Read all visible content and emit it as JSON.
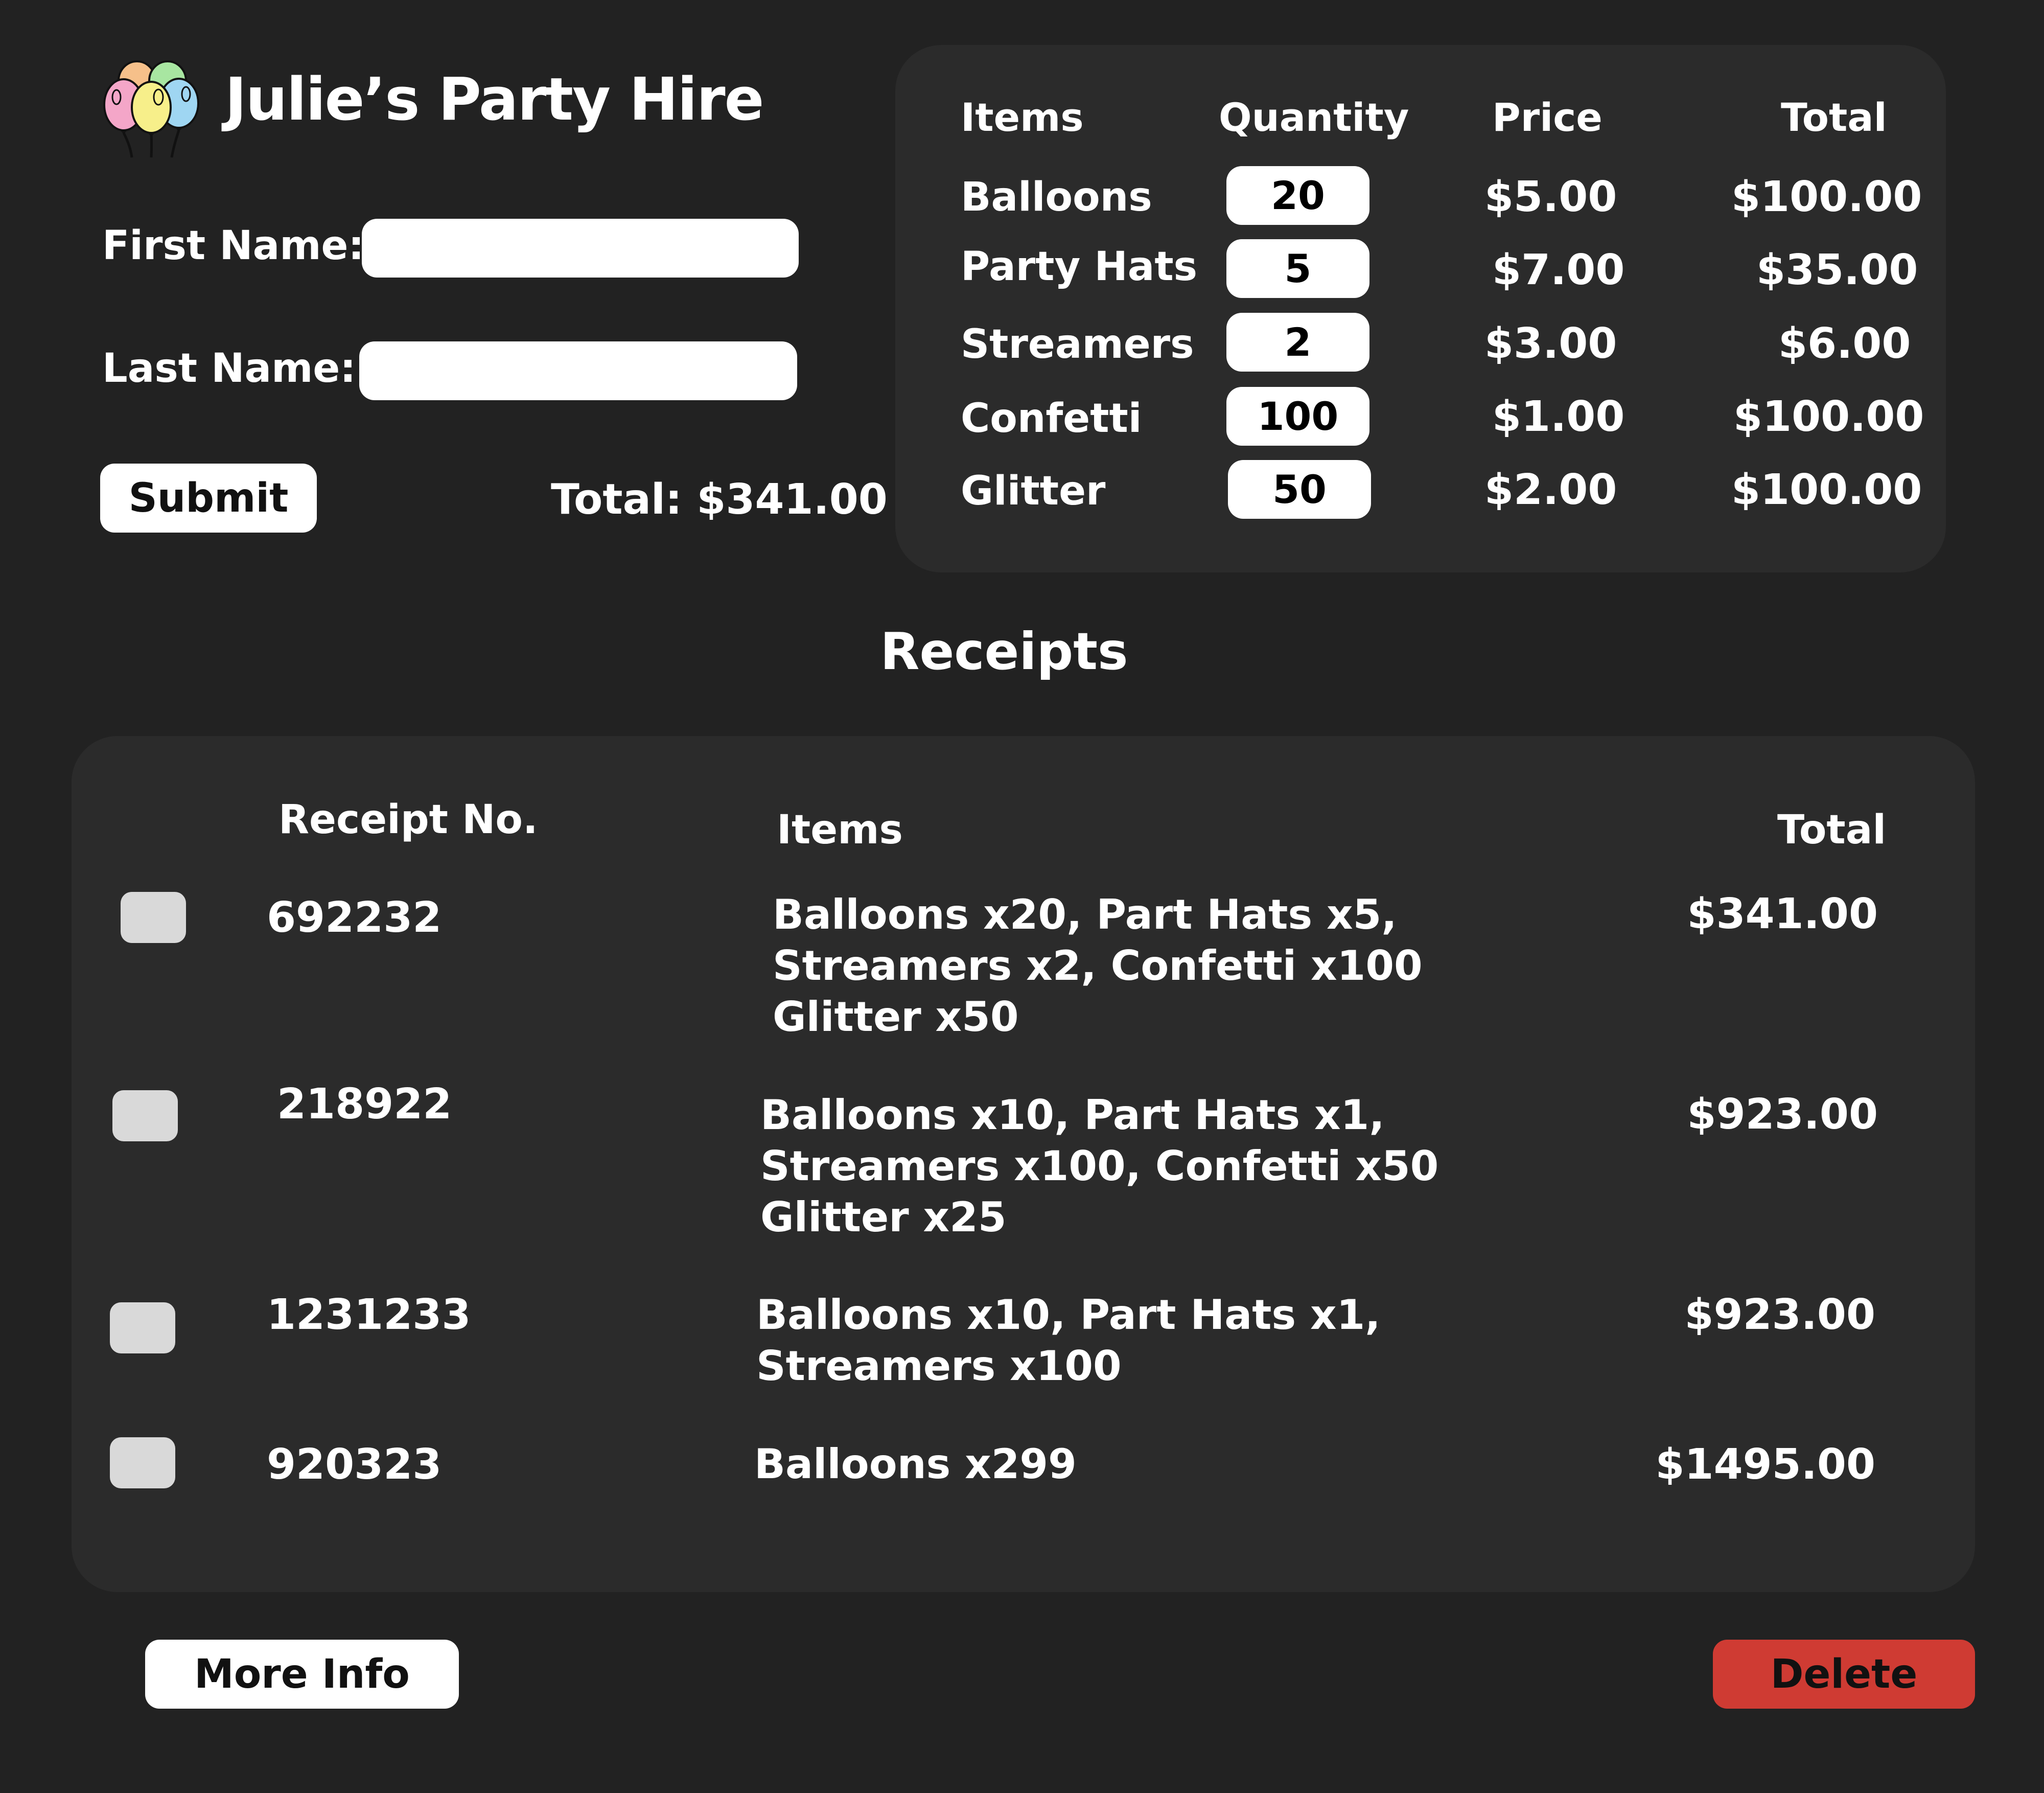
{
  "app": {
    "title": "Julie’s Party Hire",
    "logo_icon": "balloons-icon"
  },
  "form": {
    "first_name_label": "First Name:",
    "first_name_value": "",
    "last_name_label": "Last Name:",
    "last_name_value": "",
    "submit_label": "Submit",
    "total_text": "Total: $341.00"
  },
  "items_table": {
    "headers": {
      "items": "Items",
      "quantity": "Quantity",
      "price": "Price",
      "total": "Total"
    },
    "rows": [
      {
        "name": "Balloons",
        "quantity": "20",
        "price": "$5.00",
        "total": "$100.00"
      },
      {
        "name": "Party Hats",
        "quantity": "5",
        "price": "$7.00",
        "total": "$35.00"
      },
      {
        "name": "Streamers",
        "quantity": "2",
        "price": "$3.00",
        "total": "$6.00"
      },
      {
        "name": "Confetti",
        "quantity": "100",
        "price": "$1.00",
        "total": "$100.00"
      },
      {
        "name": "Glitter",
        "quantity": "50",
        "price": "$2.00",
        "total": "$100.00"
      }
    ]
  },
  "receipts": {
    "title": "Receipts",
    "headers": {
      "receipt_no": "Receipt No.",
      "items": "Items",
      "total": "Total"
    },
    "rows": [
      {
        "receipt_no": "692232",
        "item_lines": [
          "Balloons  x20, Part Hats x5,",
          "Streamers x2, Confetti x100",
          "Glitter x50"
        ],
        "total": "$341.00"
      },
      {
        "receipt_no": "218922",
        "item_lines": [
          "Balloons  x10, Part Hats x1,",
          "Streamers x100, Confetti x50",
          "Glitter x25"
        ],
        "total": "$923.00"
      },
      {
        "receipt_no": "1231233",
        "item_lines": [
          "Balloons  x10, Part Hats x1,",
          "Streamers x100"
        ],
        "total": "$923.00"
      },
      {
        "receipt_no": "920323",
        "item_lines": [
          "Balloons  x299"
        ],
        "total": "$1495.00"
      }
    ]
  },
  "actions": {
    "more_info_label": "More Info",
    "delete_label": "Delete"
  },
  "colors": {
    "background": "#222222",
    "panel": "#2b2b2b",
    "checkbox": "#d9d9d9",
    "delete": "#cf3b33",
    "balloon_pink": "#f4a6c8",
    "balloon_yellow": "#f7ef8a",
    "balloon_blue": "#9fd6f2",
    "balloon_orange": "#f6c08a",
    "balloon_green": "#a8e6a1"
  }
}
